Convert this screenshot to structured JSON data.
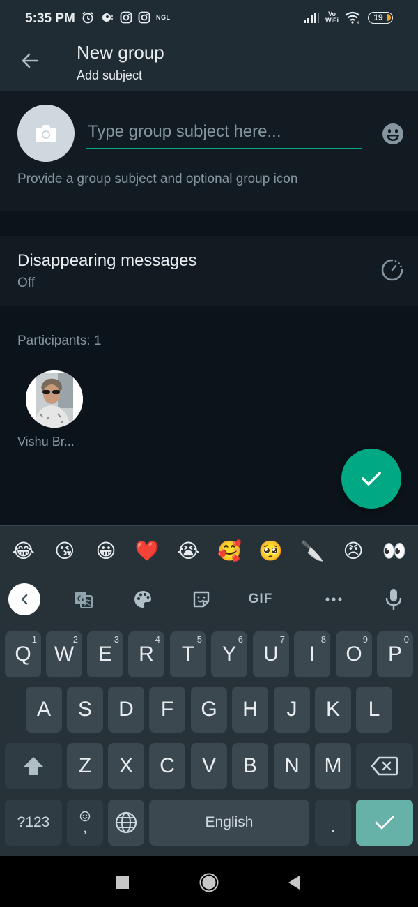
{
  "status_bar": {
    "time": "5:35 PM",
    "left_icons": [
      "alarm-icon",
      "chat-bubble-icon",
      "instagram-icon",
      "instagram-icon",
      "ngl-icon"
    ],
    "ngl_label": "NGL",
    "vowifi_top": "Vo",
    "vowifi_bottom": "WiFi",
    "battery_level": "19",
    "battery_color": "#f5a623"
  },
  "app_bar": {
    "title": "New group",
    "subtitle": "Add subject",
    "back_icon": "arrow-left-icon"
  },
  "subject": {
    "value": "",
    "placeholder": "Type group subject here...",
    "hint": "Provide a group subject and optional group icon",
    "avatar_icon": "camera-icon",
    "emoji_icon": "emoji-icon",
    "accent_color": "#00a884"
  },
  "disappearing": {
    "title": "Disappearing messages",
    "value": "Off",
    "icon": "timer-icon"
  },
  "participants": {
    "label": "Participants: 1",
    "list": [
      {
        "name": "Vishu Br..."
      }
    ]
  },
  "fab": {
    "icon": "check-icon"
  },
  "keyboard": {
    "emoji_suggestions": [
      "😂",
      "😘",
      "😀",
      "❤️",
      "😭",
      "🥰",
      "🥺",
      "🔪",
      "😠",
      "👀"
    ],
    "toolbar": {
      "back_icon": "chevron-left-icon",
      "translate_icon": "translate-icon",
      "theme_icon": "palette-icon",
      "sticker_icon": "sticker-icon",
      "gif_label": "GIF",
      "more_icon": "more-horizontal-icon",
      "mic_icon": "microphone-icon"
    },
    "row1": [
      {
        "key": "Q",
        "hint": "1"
      },
      {
        "key": "W",
        "hint": "2"
      },
      {
        "key": "E",
        "hint": "3"
      },
      {
        "key": "R",
        "hint": "4"
      },
      {
        "key": "T",
        "hint": "5"
      },
      {
        "key": "Y",
        "hint": "6"
      },
      {
        "key": "U",
        "hint": "7"
      },
      {
        "key": "I",
        "hint": "8"
      },
      {
        "key": "O",
        "hint": "9"
      },
      {
        "key": "P",
        "hint": "0"
      }
    ],
    "row2": [
      "A",
      "S",
      "D",
      "F",
      "G",
      "H",
      "J",
      "K",
      "L"
    ],
    "row3": [
      "Z",
      "X",
      "C",
      "V",
      "B",
      "N",
      "M"
    ],
    "symbols_label": "?123",
    "comma_label": ",",
    "space_label": "English",
    "period_label": "."
  },
  "nav_bar": {
    "recents_icon": "square-icon",
    "home_icon": "circle-icon",
    "back_icon": "triangle-back-icon"
  }
}
